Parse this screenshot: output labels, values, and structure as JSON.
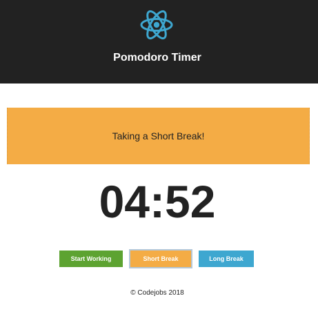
{
  "header": {
    "title": "Pomodoro Timer",
    "logo_icon": "react-atom-icon",
    "background_color": "#222222",
    "logo_color": "#3ea7d0"
  },
  "status": {
    "message": "Taking a Short Break!",
    "background_color": "#f4ac45"
  },
  "timer": {
    "display": "04:52"
  },
  "controls": {
    "start_working_label": "Start Working",
    "short_break_label": "Short Break",
    "long_break_label": "Long Break",
    "start_working_color": "#5da331",
    "short_break_color": "#f4ac45",
    "long_break_color": "#3ea7d0",
    "active_mode": "Short Break"
  },
  "footer": {
    "copyright": "© Codejobs 2018"
  }
}
